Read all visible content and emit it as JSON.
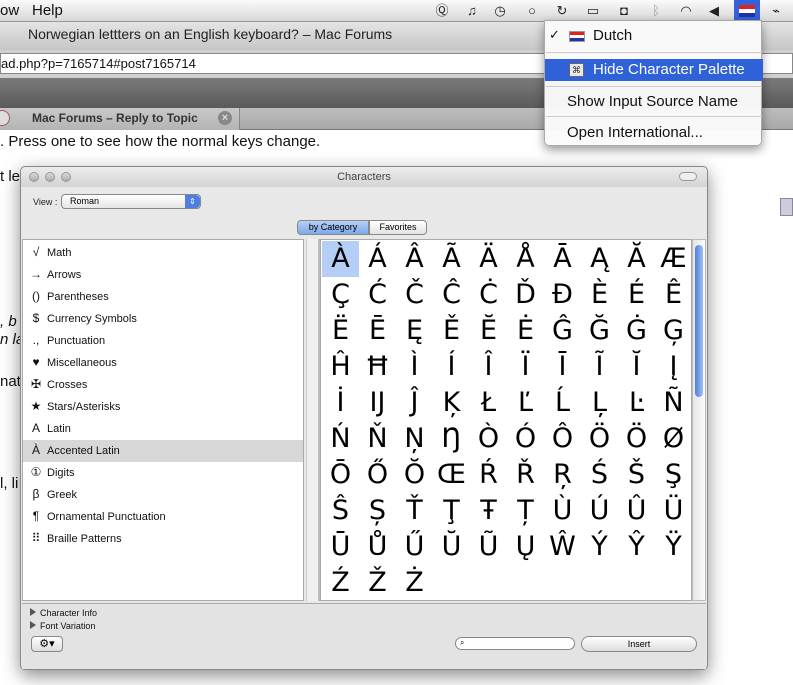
{
  "menubar": {
    "items": [
      "ow",
      "Help"
    ],
    "tray_icons": [
      "q-icon",
      "headphones-icon",
      "time-machine-icon",
      "chat-icon",
      "sync-icon",
      "display-icon",
      "script-icon",
      "bluetooth-icon",
      "wifi-icon",
      "volume-icon",
      "dutch-flag-icon",
      "activity-icon"
    ]
  },
  "window": {
    "title": "Norwegian lettters on an English keyboard? – Mac Forums",
    "url": "ad.php?p=7165714#post7165714",
    "tab_label": "Mac Forums – Reply to Topic"
  },
  "page": {
    "lines": [
      ". Press one to see how the normal keys change.",
      "t le",
      ", b",
      "n la",
      "nat",
      "l, li"
    ]
  },
  "input_menu": {
    "items": [
      {
        "label": "Dutch",
        "checked": true
      },
      {
        "label": "Hide Character Palette",
        "selected": true
      },
      {
        "label": "Show Input Source Name"
      },
      {
        "label": "Open International..."
      }
    ]
  },
  "palette": {
    "title": "Characters",
    "view_label": "View :",
    "view_value": "Roman",
    "tabs": [
      "by Category",
      "Favorites"
    ],
    "categories": [
      {
        "glyph": "√",
        "label": "Math"
      },
      {
        "glyph": "→",
        "label": "Arrows"
      },
      {
        "glyph": "()",
        "label": "Parentheses"
      },
      {
        "glyph": "$",
        "label": "Currency Symbols"
      },
      {
        "glyph": ".,",
        "label": "Punctuation"
      },
      {
        "glyph": "♥",
        "label": "Miscellaneous"
      },
      {
        "glyph": "✠",
        "label": "Crosses"
      },
      {
        "glyph": "★",
        "label": "Stars/Asterisks"
      },
      {
        "glyph": "A",
        "label": "Latin"
      },
      {
        "glyph": "À",
        "label": "Accented Latin",
        "selected": true
      },
      {
        "glyph": "①",
        "label": "Digits"
      },
      {
        "glyph": "β",
        "label": "Greek"
      },
      {
        "glyph": "¶",
        "label": "Ornamental Punctuation"
      },
      {
        "glyph": "⠿",
        "label": "Braille Patterns"
      }
    ],
    "characters": [
      "À",
      "Á",
      "Â",
      "Ã",
      "Ä",
      "Å",
      "Ā",
      "Ą",
      "Ă",
      "Æ",
      "Ç",
      "Ć",
      "Č",
      "Ĉ",
      "Ċ",
      "Ď",
      "Đ",
      "È",
      "É",
      "Ê",
      "Ë",
      "Ē",
      "Ę",
      "Ě",
      "Ĕ",
      "Ė",
      "Ĝ",
      "Ğ",
      "Ġ",
      "Ģ",
      "Ĥ",
      "Ħ",
      "Ì",
      "Í",
      "Î",
      "Ï",
      "Ī",
      "Ĩ",
      "Ĭ",
      "Į",
      "İ",
      "Ĳ",
      "Ĵ",
      "Ķ",
      "Ł",
      "Ľ",
      "Ĺ",
      "Ļ",
      "Ŀ",
      "Ñ",
      "Ń",
      "Ň",
      "Ņ",
      "Ŋ",
      "Ò",
      "Ó",
      "Ô",
      "Ö",
      "Ö",
      "Ø",
      "Ō",
      "Ő",
      "Ŏ",
      "Œ",
      "Ŕ",
      "Ř",
      "Ŗ",
      "Ś",
      "Š",
      "Ş",
      "Ŝ",
      "Ș",
      "Ť",
      "Ţ",
      "Ŧ",
      "Ț",
      "Ù",
      "Ú",
      "Û",
      "Ü",
      "Ū",
      "Ů",
      "Ű",
      "Ŭ",
      "Ũ",
      "Ų",
      "Ŵ",
      "Ý",
      "Ŷ",
      "Ÿ",
      "Ź",
      "Ž",
      "Ż"
    ],
    "selected_index": 0,
    "character_info_label": "Character Info",
    "font_variation_label": "Font Variation",
    "gear_label": "⚙▾",
    "insert_label": "Insert"
  }
}
